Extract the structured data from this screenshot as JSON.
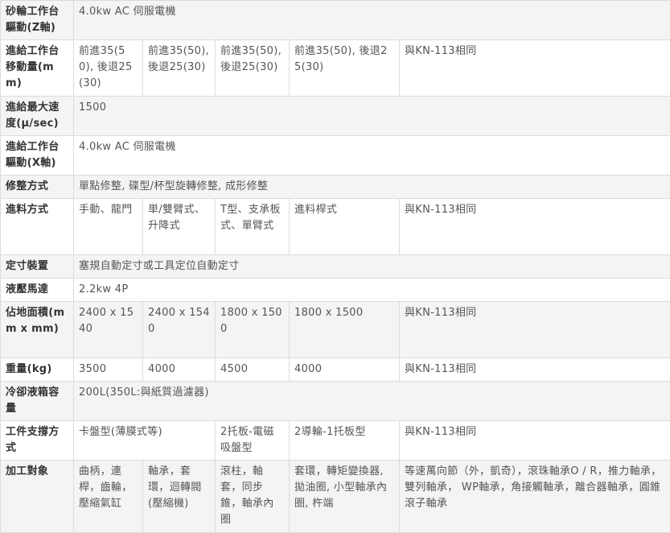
{
  "rows": [
    {
      "label": "砂輪工作台驅動(Z軸)",
      "cells": [
        "4.0kw AC 伺服電機"
      ]
    },
    {
      "label": "進給工作台移動量(mm)",
      "cells": [
        "前進35(50), 後退25(30)",
        "前進35(50), 後退25(30)",
        "前進35(50), 後退25(30)",
        "前進35(50), 後退25(30)",
        "與KN-113相同"
      ]
    },
    {
      "label": "進給最大速度(μ/sec)",
      "cells": [
        "1500"
      ]
    },
    {
      "label": "進給工作台驅動(X軸)",
      "cells": [
        "4.0kw AC 伺服電機"
      ]
    },
    {
      "label": "修整方式",
      "cells": [
        "單點修整, 碟型/杯型旋轉修整, 成形修整"
      ]
    },
    {
      "label": "進料方式",
      "cells": [
        "手動、龍門",
        "単/雙臂式、升降式",
        "T型、支承板式、單臂式",
        "進料桿式",
        "與KN-113相同"
      ]
    },
    {
      "label": "定寸裝置",
      "cells": [
        "塞規自動定寸或工具定位自動定寸"
      ]
    },
    {
      "label": "液壓馬達",
      "cells": [
        "2.2kw 4P"
      ]
    },
    {
      "label": "佔地面積(mm x mm)",
      "cells": [
        "2400 x 1540",
        "2400 x 1540",
        "1800 x 1500",
        "1800 x 1500",
        "與KN-113相同"
      ]
    },
    {
      "label": "重量(kg)",
      "cells": [
        "3500",
        "4000",
        "4500",
        "4000",
        "與KN-113相同"
      ]
    },
    {
      "label": "冷卻液箱容量",
      "cells": [
        "200L(350L:與紙質過濾器)"
      ]
    },
    {
      "label": "工件支撐方式",
      "cells": [
        "卡盤型(薄膜式等)",
        "2托板-電磁吸盤型",
        "2導輪-1托板型",
        "與KN-113相同"
      ]
    },
    {
      "label": "加工對象",
      "cells": [
        "曲柄，連桿，齒輪，壓縮氣缸",
        "軸承，套環，迴轉閥(壓縮機)",
        "滾柱，軸套，同步錐，軸承內圈",
        "套環，轉矩變換器, 拋油圈, 小型軸承內圈, 杵端",
        "等速萬向節（外，凱奇），滾珠軸承O / R，推力軸承，雙列軸承， WP軸承，角接觸軸承，離合器軸承，圓錐滾子軸承"
      ]
    }
  ]
}
